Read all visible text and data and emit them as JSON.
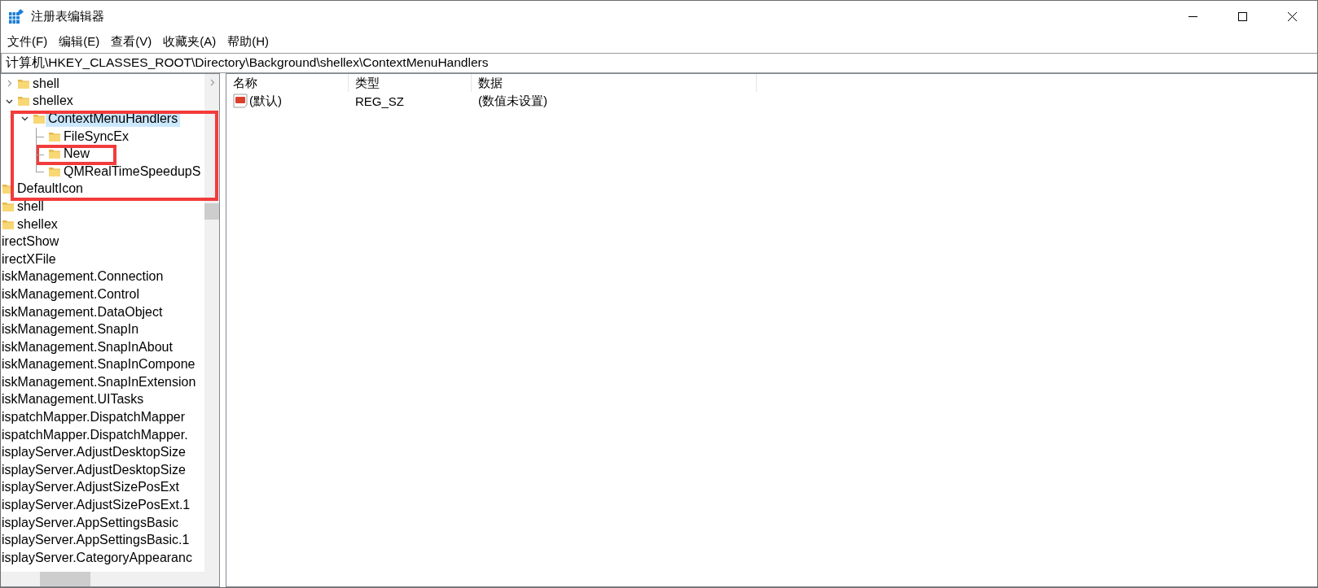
{
  "window": {
    "title": "注册表编辑器"
  },
  "menu": [
    "文件(F)",
    "编辑(E)",
    "查看(V)",
    "收藏夹(A)",
    "帮助(H)"
  ],
  "address": "计算机\\HKEY_CLASSES_ROOT\\Directory\\Background\\shellex\\ContextMenuHandlers",
  "tree": [
    {
      "children": [
        {
          "children": [
            {
              "label": "shell",
              "expanded": false
            },
            {
              "label": "shellex",
              "expanded": true,
              "children": [
                {
                  "label": "ContextMenuHandlers",
                  "expanded": true,
                  "selected": true,
                  "children": [
                    {
                      "label": "FileSyncEx",
                      "selected": false
                    },
                    {
                      "label": "New",
                      "selected": false
                    },
                    {
                      "label": "QMRealTimeSpeedupS",
                      "selected": false
                    }
                  ]
                }
              ]
            }
          ]
        },
        {
          "label": "DefaultIcon",
          "selected": false
        },
        {
          "label": "shell",
          "selected": false
        },
        {
          "label": "shellex",
          "selected": false
        }
      ]
    },
    {
      "label": "irectShow"
    },
    {
      "label": "irectXFile"
    },
    {
      "label": "iskManagement.Connection"
    },
    {
      "label": "iskManagement.Control"
    },
    {
      "label": "iskManagement.DataObject"
    },
    {
      "label": "iskManagement.SnapIn"
    },
    {
      "label": "iskManagement.SnapInAbout"
    },
    {
      "label": "iskManagement.SnapInCompone"
    },
    {
      "label": "iskManagement.SnapInExtension"
    },
    {
      "label": "iskManagement.UITasks"
    },
    {
      "label": "ispatchMapper.DispatchMapper"
    },
    {
      "label": "ispatchMapper.DispatchMapper."
    },
    {
      "label": "isplayServer.AdjustDesktopSize"
    },
    {
      "label": "isplayServer.AdjustDesktopSize"
    },
    {
      "label": "isplayServer.AdjustSizePosExt"
    },
    {
      "label": "isplayServer.AdjustSizePosExt.1"
    },
    {
      "label": "isplayServer.AppSettingsBasic"
    },
    {
      "label": "isplayServer.AppSettingsBasic.1"
    },
    {
      "label": "isplayServer.CategoryAppearanc"
    }
  ],
  "values": {
    "columns": [
      "名称",
      "类型",
      "数据"
    ],
    "rows": [
      {
        "kind": "string",
        "cells": [
          "(默认)",
          "REG_SZ",
          "(数值未设置)"
        ]
      }
    ]
  }
}
